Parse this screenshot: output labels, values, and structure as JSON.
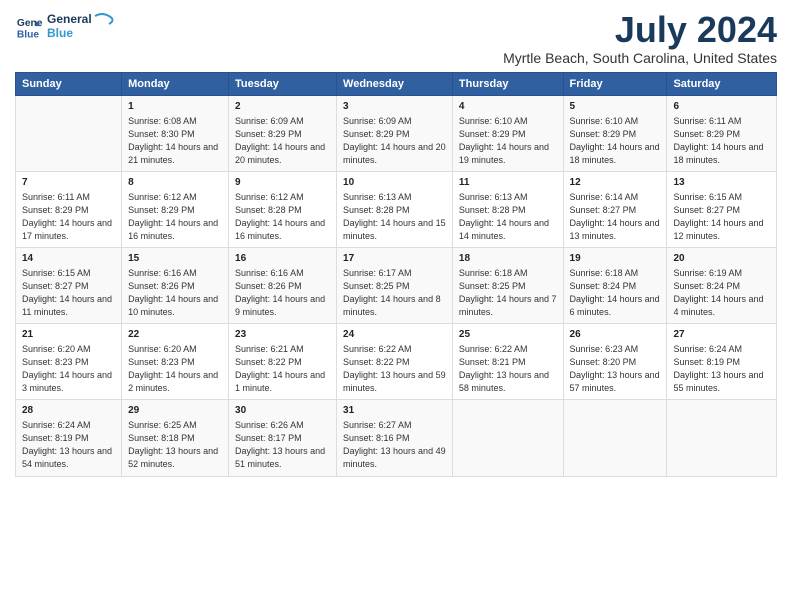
{
  "logo": {
    "line1": "General",
    "line2": "Blue"
  },
  "title": "July 2024",
  "subtitle": "Myrtle Beach, South Carolina, United States",
  "days_of_week": [
    "Sunday",
    "Monday",
    "Tuesday",
    "Wednesday",
    "Thursday",
    "Friday",
    "Saturday"
  ],
  "weeks": [
    [
      {
        "date": "",
        "sunrise": "",
        "sunset": "",
        "daylight": ""
      },
      {
        "date": "1",
        "sunrise": "Sunrise: 6:08 AM",
        "sunset": "Sunset: 8:30 PM",
        "daylight": "Daylight: 14 hours and 21 minutes."
      },
      {
        "date": "2",
        "sunrise": "Sunrise: 6:09 AM",
        "sunset": "Sunset: 8:29 PM",
        "daylight": "Daylight: 14 hours and 20 minutes."
      },
      {
        "date": "3",
        "sunrise": "Sunrise: 6:09 AM",
        "sunset": "Sunset: 8:29 PM",
        "daylight": "Daylight: 14 hours and 20 minutes."
      },
      {
        "date": "4",
        "sunrise": "Sunrise: 6:10 AM",
        "sunset": "Sunset: 8:29 PM",
        "daylight": "Daylight: 14 hours and 19 minutes."
      },
      {
        "date": "5",
        "sunrise": "Sunrise: 6:10 AM",
        "sunset": "Sunset: 8:29 PM",
        "daylight": "Daylight: 14 hours and 18 minutes."
      },
      {
        "date": "6",
        "sunrise": "Sunrise: 6:11 AM",
        "sunset": "Sunset: 8:29 PM",
        "daylight": "Daylight: 14 hours and 18 minutes."
      }
    ],
    [
      {
        "date": "7",
        "sunrise": "Sunrise: 6:11 AM",
        "sunset": "Sunset: 8:29 PM",
        "daylight": "Daylight: 14 hours and 17 minutes."
      },
      {
        "date": "8",
        "sunrise": "Sunrise: 6:12 AM",
        "sunset": "Sunset: 8:29 PM",
        "daylight": "Daylight: 14 hours and 16 minutes."
      },
      {
        "date": "9",
        "sunrise": "Sunrise: 6:12 AM",
        "sunset": "Sunset: 8:28 PM",
        "daylight": "Daylight: 14 hours and 16 minutes."
      },
      {
        "date": "10",
        "sunrise": "Sunrise: 6:13 AM",
        "sunset": "Sunset: 8:28 PM",
        "daylight": "Daylight: 14 hours and 15 minutes."
      },
      {
        "date": "11",
        "sunrise": "Sunrise: 6:13 AM",
        "sunset": "Sunset: 8:28 PM",
        "daylight": "Daylight: 14 hours and 14 minutes."
      },
      {
        "date": "12",
        "sunrise": "Sunrise: 6:14 AM",
        "sunset": "Sunset: 8:27 PM",
        "daylight": "Daylight: 14 hours and 13 minutes."
      },
      {
        "date": "13",
        "sunrise": "Sunrise: 6:15 AM",
        "sunset": "Sunset: 8:27 PM",
        "daylight": "Daylight: 14 hours and 12 minutes."
      }
    ],
    [
      {
        "date": "14",
        "sunrise": "Sunrise: 6:15 AM",
        "sunset": "Sunset: 8:27 PM",
        "daylight": "Daylight: 14 hours and 11 minutes."
      },
      {
        "date": "15",
        "sunrise": "Sunrise: 6:16 AM",
        "sunset": "Sunset: 8:26 PM",
        "daylight": "Daylight: 14 hours and 10 minutes."
      },
      {
        "date": "16",
        "sunrise": "Sunrise: 6:16 AM",
        "sunset": "Sunset: 8:26 PM",
        "daylight": "Daylight: 14 hours and 9 minutes."
      },
      {
        "date": "17",
        "sunrise": "Sunrise: 6:17 AM",
        "sunset": "Sunset: 8:25 PM",
        "daylight": "Daylight: 14 hours and 8 minutes."
      },
      {
        "date": "18",
        "sunrise": "Sunrise: 6:18 AM",
        "sunset": "Sunset: 8:25 PM",
        "daylight": "Daylight: 14 hours and 7 minutes."
      },
      {
        "date": "19",
        "sunrise": "Sunrise: 6:18 AM",
        "sunset": "Sunset: 8:24 PM",
        "daylight": "Daylight: 14 hours and 6 minutes."
      },
      {
        "date": "20",
        "sunrise": "Sunrise: 6:19 AM",
        "sunset": "Sunset: 8:24 PM",
        "daylight": "Daylight: 14 hours and 4 minutes."
      }
    ],
    [
      {
        "date": "21",
        "sunrise": "Sunrise: 6:20 AM",
        "sunset": "Sunset: 8:23 PM",
        "daylight": "Daylight: 14 hours and 3 minutes."
      },
      {
        "date": "22",
        "sunrise": "Sunrise: 6:20 AM",
        "sunset": "Sunset: 8:23 PM",
        "daylight": "Daylight: 14 hours and 2 minutes."
      },
      {
        "date": "23",
        "sunrise": "Sunrise: 6:21 AM",
        "sunset": "Sunset: 8:22 PM",
        "daylight": "Daylight: 14 hours and 1 minute."
      },
      {
        "date": "24",
        "sunrise": "Sunrise: 6:22 AM",
        "sunset": "Sunset: 8:22 PM",
        "daylight": "Daylight: 13 hours and 59 minutes."
      },
      {
        "date": "25",
        "sunrise": "Sunrise: 6:22 AM",
        "sunset": "Sunset: 8:21 PM",
        "daylight": "Daylight: 13 hours and 58 minutes."
      },
      {
        "date": "26",
        "sunrise": "Sunrise: 6:23 AM",
        "sunset": "Sunset: 8:20 PM",
        "daylight": "Daylight: 13 hours and 57 minutes."
      },
      {
        "date": "27",
        "sunrise": "Sunrise: 6:24 AM",
        "sunset": "Sunset: 8:19 PM",
        "daylight": "Daylight: 13 hours and 55 minutes."
      }
    ],
    [
      {
        "date": "28",
        "sunrise": "Sunrise: 6:24 AM",
        "sunset": "Sunset: 8:19 PM",
        "daylight": "Daylight: 13 hours and 54 minutes."
      },
      {
        "date": "29",
        "sunrise": "Sunrise: 6:25 AM",
        "sunset": "Sunset: 8:18 PM",
        "daylight": "Daylight: 13 hours and 52 minutes."
      },
      {
        "date": "30",
        "sunrise": "Sunrise: 6:26 AM",
        "sunset": "Sunset: 8:17 PM",
        "daylight": "Daylight: 13 hours and 51 minutes."
      },
      {
        "date": "31",
        "sunrise": "Sunrise: 6:27 AM",
        "sunset": "Sunset: 8:16 PM",
        "daylight": "Daylight: 13 hours and 49 minutes."
      },
      {
        "date": "",
        "sunrise": "",
        "sunset": "",
        "daylight": ""
      },
      {
        "date": "",
        "sunrise": "",
        "sunset": "",
        "daylight": ""
      },
      {
        "date": "",
        "sunrise": "",
        "sunset": "",
        "daylight": ""
      }
    ]
  ]
}
